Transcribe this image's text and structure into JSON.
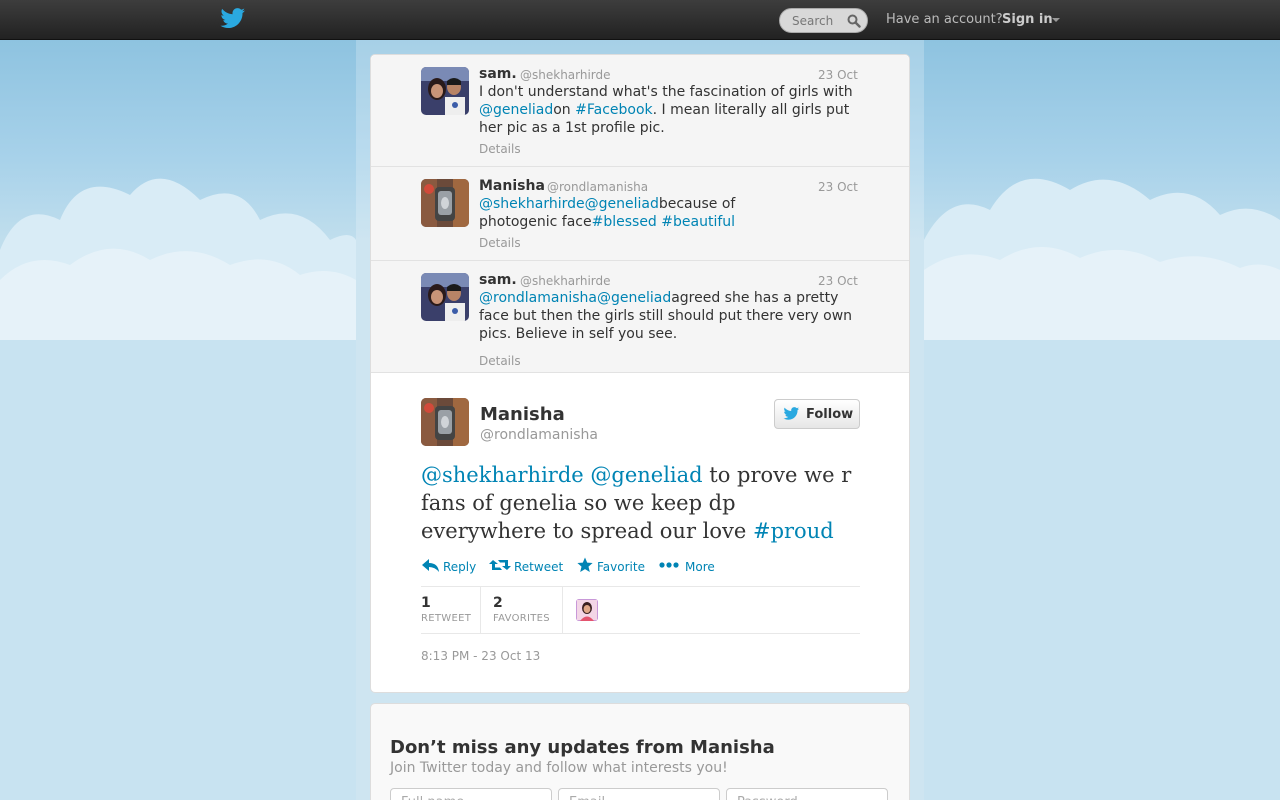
{
  "header": {
    "search_placeholder": "Search",
    "have_account": "Have an account?",
    "sign_in": "Sign in"
  },
  "conversation": [
    {
      "name": "sam.",
      "handle": "@shekharhirde",
      "date": "23 Oct",
      "text_parts": [
        "I don't understand what's the fascination of girls with ",
        "@geneliad",
        "on ",
        "#Facebook",
        ". I mean literally all girls put her pic as a 1st profile pic."
      ],
      "details": "Details"
    },
    {
      "name": "Manisha",
      "handle": "@rondlamanisha",
      "date": "23 Oct",
      "text_parts": [
        "@shekharhirde",
        "@geneliad",
        "because of photogenic face",
        "#blessed",
        " ",
        "#beautiful"
      ],
      "details": "Details"
    },
    {
      "name": "sam.",
      "handle": "@shekharhirde",
      "date": "23 Oct",
      "text_parts": [
        "@rondlamanisha",
        "@geneliad",
        "agreed she has a pretty face but then the girls still should put there very own pics. Believe in self you see."
      ],
      "details": "Details"
    }
  ],
  "permalink": {
    "name": "Manisha",
    "handle": "@rondlamanisha",
    "follow_label": "Follow",
    "text_parts": [
      "@shekharhirde",
      " ",
      "@geneliad",
      " to prove we r fans of genelia so we keep dp everywhere to spread our love ",
      "#proud"
    ],
    "actions": [
      "Reply",
      "Retweet",
      "Favorite",
      "More"
    ],
    "retweets": {
      "count": "1",
      "label": "RETWEET"
    },
    "favorites": {
      "count": "2",
      "label": "FAVORITES"
    },
    "timestamp": "8:13 PM - 23 Oct 13"
  },
  "signup": {
    "title": "Don’t miss any updates from Manisha",
    "subtitle": "Join Twitter today and follow what interests you!",
    "fields": [
      "Full name",
      "Email",
      "Password"
    ]
  },
  "colors": {
    "link": "#0084b4",
    "topbar": "#2b2b2b",
    "background": "#c0deed"
  },
  "icons": [
    "twitter-bird-icon",
    "search-icon",
    "reply-icon",
    "retweet-icon",
    "favorite-star-icon",
    "more-dots-icon"
  ]
}
